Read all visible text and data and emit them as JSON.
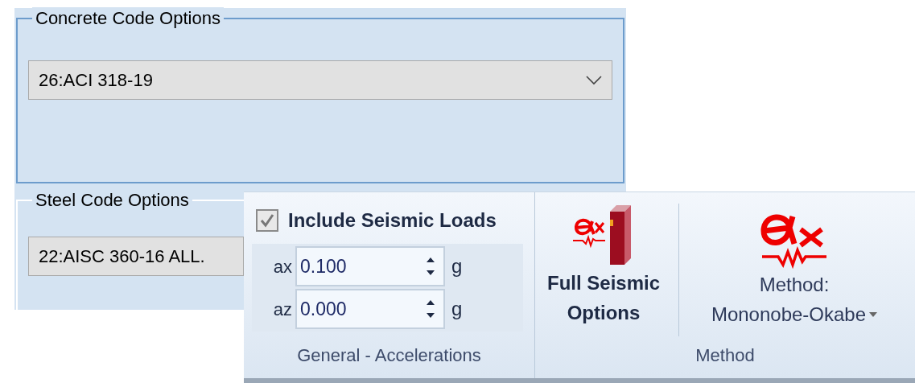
{
  "concrete_code": {
    "title": "Concrete Code Options",
    "combo": {
      "value": "26:ACI 318-19"
    }
  },
  "steel_code": {
    "title": "Steel Code Options",
    "combo": {
      "value": "22:AISC 360-16 ALL."
    }
  },
  "ribbon": {
    "groups": [
      {
        "kind": "accelerations",
        "label": "General - Accelerations",
        "checkbox": {
          "label": "Include Seismic Loads",
          "checked": true
        },
        "inputs": [
          {
            "label": "ax",
            "value": "0.100",
            "unit": "g"
          },
          {
            "label": "az",
            "value": "0.000",
            "unit": "g"
          }
        ]
      },
      {
        "kind": "method",
        "label": "Method",
        "buttons": [
          {
            "kind": "book",
            "lines": [
              "Full Seismic",
              "Options"
            ]
          },
          {
            "kind": "dropdown",
            "lines": [
              "Method:",
              "Mononobe-Okabe"
            ]
          }
        ]
      }
    ]
  }
}
